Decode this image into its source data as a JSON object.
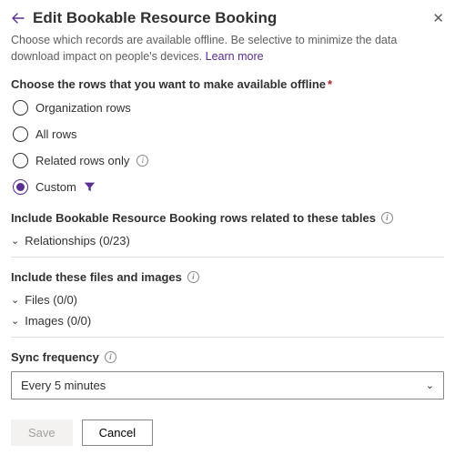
{
  "header": {
    "title": "Edit Bookable Resource Booking",
    "subtitle_before_link": "Choose which records are available offline. Be selective to minimize the data download impact on people's devices. ",
    "learn_more": "Learn more"
  },
  "rows_section": {
    "label": "Choose the rows that you want to make available offline",
    "options": {
      "organization": "Organization rows",
      "all": "All rows",
      "related": "Related rows only",
      "custom": "Custom"
    },
    "selected": "custom"
  },
  "include_related": {
    "label": "Include Bookable Resource Booking rows related to these tables",
    "relationships_label": "Relationships (0/23)"
  },
  "include_files": {
    "label": "Include these files and images",
    "files_label": "Files (0/0)",
    "images_label": "Images (0/0)"
  },
  "sync": {
    "label": "Sync frequency",
    "value": "Every 5 minutes"
  },
  "footer": {
    "save": "Save",
    "cancel": "Cancel"
  }
}
